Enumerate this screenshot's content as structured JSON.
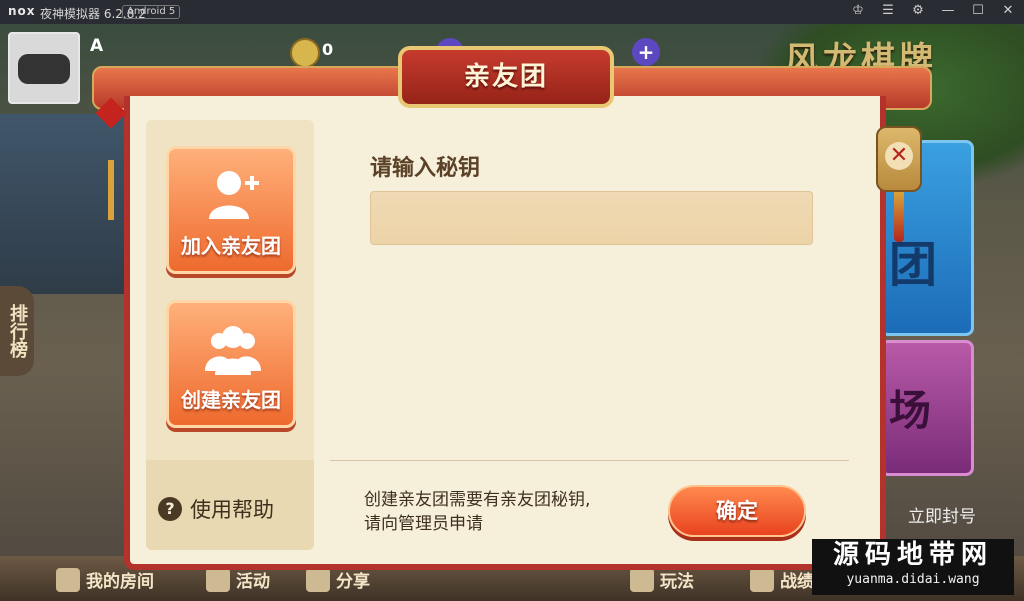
{
  "emulator": {
    "logo": "nox",
    "app_title": "夜神模拟器 6.2.8.2",
    "android_badge": "Android 5"
  },
  "hud": {
    "player_name": "A",
    "coins": "0",
    "brand": "风龙棋牌"
  },
  "side_left": {
    "rank_label": "排行榜"
  },
  "side_right": {
    "tile1": "团",
    "tile2": "场",
    "link": "立即封号"
  },
  "bottom_nav": {
    "items": [
      {
        "label": "我的房间"
      },
      {
        "label": "活动"
      },
      {
        "label": "分享"
      },
      {
        "label": "玩法"
      },
      {
        "label": "战绩"
      }
    ]
  },
  "dialog": {
    "title": "亲友团",
    "menu": [
      {
        "label": "加入亲友团",
        "icon": "add-user-icon"
      },
      {
        "label": "创建亲友团",
        "icon": "group-icon"
      }
    ],
    "help_label": "使用帮助",
    "prompt": "请输入秘钥",
    "key_value": "",
    "note_line1": "创建亲友团需要有亲友团秘钥,",
    "note_line2": "请向管理员申请",
    "confirm_label": "确定"
  },
  "watermark": {
    "cn": "源码地带网",
    "url": "yuanma.didai.wang"
  },
  "colors": {
    "dialog_bg": "#f6efd9",
    "accent_red": "#b3332c",
    "button_orange": "#ee6a2e"
  }
}
